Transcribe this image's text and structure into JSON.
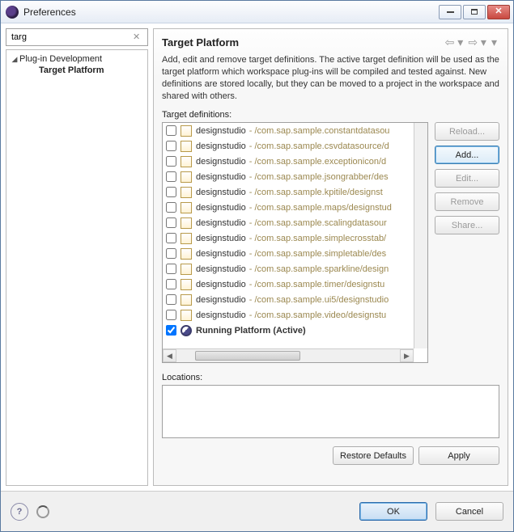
{
  "window": {
    "title": "Preferences"
  },
  "search": {
    "value": "targ"
  },
  "tree": {
    "parent": "Plug-in Development",
    "child": "Target Platform"
  },
  "header": {
    "title": "Target Platform"
  },
  "description": "Add, edit and remove target definitions.  The active target definition will be used as the target platform which workspace plug-ins will be compiled and tested against.  New definitions are stored locally, but they can be moved to a project in the workspace and shared with others.",
  "defs_label": "Target definitions:",
  "definitions": [
    {
      "checked": false,
      "name": "designstudio",
      "path": " - /com.sap.sample.constantdatasou"
    },
    {
      "checked": false,
      "name": "designstudio",
      "path": " - /com.sap.sample.csvdatasource/d"
    },
    {
      "checked": false,
      "name": "designstudio",
      "path": " - /com.sap.sample.exceptionicon/d"
    },
    {
      "checked": false,
      "name": "designstudio",
      "path": " - /com.sap.sample.jsongrabber/des"
    },
    {
      "checked": false,
      "name": "designstudio",
      "path": " - /com.sap.sample.kpitile/designst"
    },
    {
      "checked": false,
      "name": "designstudio",
      "path": " - /com.sap.sample.maps/designstud"
    },
    {
      "checked": false,
      "name": "designstudio",
      "path": " - /com.sap.sample.scalingdatasour"
    },
    {
      "checked": false,
      "name": "designstudio",
      "path": " - /com.sap.sample.simplecrosstab/"
    },
    {
      "checked": false,
      "name": "designstudio",
      "path": " - /com.sap.sample.simpletable/des"
    },
    {
      "checked": false,
      "name": "designstudio",
      "path": " - /com.sap.sample.sparkline/design"
    },
    {
      "checked": false,
      "name": "designstudio",
      "path": " - /com.sap.sample.timer/designstu"
    },
    {
      "checked": false,
      "name": "designstudio",
      "path": " - /com.sap.sample.ui5/designstudio"
    },
    {
      "checked": false,
      "name": "designstudio",
      "path": " - /com.sap.sample.video/designstu"
    },
    {
      "checked": true,
      "name": "Running Platform (Active)",
      "path": "",
      "running": true
    }
  ],
  "side_buttons": {
    "reload": "Reload...",
    "add": "Add...",
    "edit": "Edit...",
    "remove": "Remove",
    "share": "Share..."
  },
  "locations_label": "Locations:",
  "bottom_buttons": {
    "restore": "Restore Defaults",
    "apply": "Apply"
  },
  "footer_buttons": {
    "ok": "OK",
    "cancel": "Cancel"
  }
}
